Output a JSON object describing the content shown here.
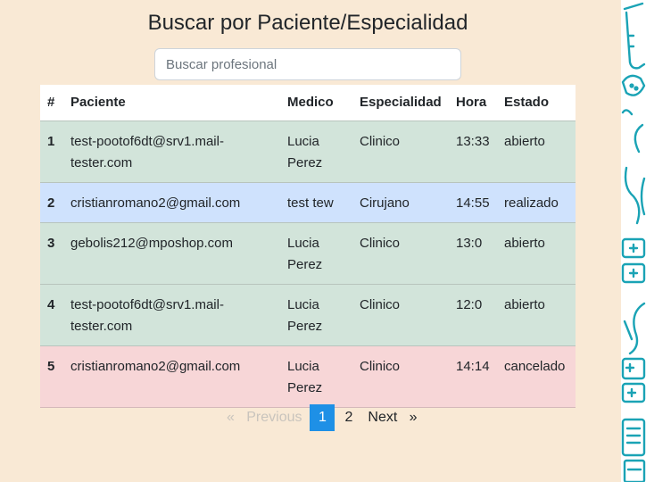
{
  "page": {
    "title": "Buscar por Paciente/Especialidad"
  },
  "search": {
    "placeholder": "Buscar profesional",
    "value": ""
  },
  "table": {
    "headers": [
      "#",
      "Paciente",
      "Medico",
      "Especialidad",
      "Hora",
      "Estado"
    ],
    "rows": [
      {
        "num": "1",
        "paciente": "test-pootof6dt@srv1.mail-tester.com",
        "medico": "Lucia Perez",
        "especialidad": "Clinico",
        "hora": "13:33",
        "estado": "abierto"
      },
      {
        "num": "2",
        "paciente": "cristianromano2@gmail.com",
        "medico": "test tew",
        "especialidad": "Cirujano",
        "hora": "14:55",
        "estado": "realizado"
      },
      {
        "num": "3",
        "paciente": "gebolis212@mposhop.com",
        "medico": "Lucia Perez",
        "especialidad": "Clinico",
        "hora": "13:0",
        "estado": "abierto"
      },
      {
        "num": "4",
        "paciente": "test-pootof6dt@srv1.mail-tester.com",
        "medico": "Lucia Perez",
        "especialidad": "Clinico",
        "hora": "12:0",
        "estado": "abierto"
      },
      {
        "num": "5",
        "paciente": "cristianromano2@gmail.com",
        "medico": "Lucia Perez",
        "especialidad": "Clinico",
        "hora": "14:14",
        "estado": "cancelado"
      }
    ]
  },
  "pagination": {
    "previous": "«   Previous",
    "pages": [
      "1",
      "2"
    ],
    "active": "1",
    "next": "Next   »"
  },
  "colors": {
    "background": "#f9e9d5",
    "row_abierto": "#d2e4da",
    "row_realizado": "#cfe2fd",
    "row_cancelado": "#f7d6d7",
    "active_page": "#1e90e6",
    "decor_teal": "#1aa3b5"
  },
  "decoration": {
    "icons": [
      "test-tube-icon",
      "bandage-icon",
      "stethoscope-icon",
      "medical-kit-icon",
      "capsule-icon",
      "medical-kit-icon",
      "clipboard-icon"
    ]
  }
}
